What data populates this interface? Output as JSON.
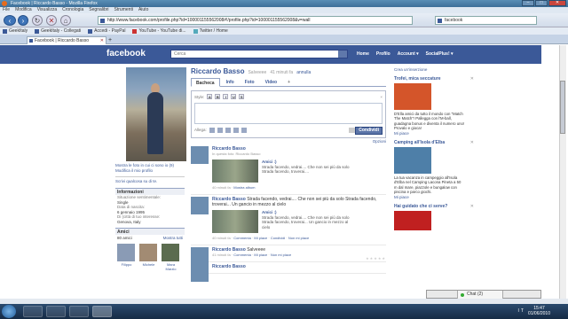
{
  "window": {
    "title": "Facebook | Riccardo Basso - Mozilla Firefox",
    "menu": [
      "File",
      "Modifica",
      "Visualizza",
      "Cronologia",
      "Segnalibri",
      "Strumenti",
      "Aiuto"
    ]
  },
  "browser": {
    "url": "http://www.facebook.com/profile.php?id=100001155562008#!/profile.php?id=100001155562008&v=wall",
    "search": "facebook",
    "bookmarks": [
      "GeekItaly",
      "GeekItaly - Collegati",
      "Accedi - PayPal",
      "YouTube - YouTube di...",
      "Twitter / Home"
    ],
    "tab_title": "Facebook | Riccardo Basso",
    "new_tab": "+"
  },
  "facebook": {
    "logo": "facebook",
    "search_placeholder": "Cerca",
    "nav": [
      "Home",
      "Profilo",
      "Account ▾",
      "SocialPlus! ▾"
    ]
  },
  "profile": {
    "name": "Riccardo Basso",
    "status": "Salveeee",
    "status_time": "41 minuti fa",
    "status_action": "annulla",
    "tabs": [
      "Bacheca",
      "Info",
      "Foto",
      "Video",
      "+"
    ],
    "left_links": [
      "Mostra le foto in cui ci sono io (9)",
      "Modifica il mio profilo"
    ],
    "about_link": "Scrivi qualcosa su di te.",
    "info_header": "Informazioni",
    "info": [
      {
        "label": "Situazione sentimentale:",
        "value": "Single"
      },
      {
        "label": "Data di nascita:",
        "value": "6 gennaio 1995"
      },
      {
        "label": "Di (città di tuo interesse:",
        "value": "Genova, Italy"
      }
    ],
    "friends_header": "Amici",
    "friends_count": "80 amici",
    "friends_all": "Mostra tutti",
    "friends": [
      "Filippo",
      "Michele",
      "Mara Marzio"
    ]
  },
  "composer": {
    "style_label": "Style:",
    "style_buttons": [
      "A",
      "B",
      "I",
      "U",
      "S"
    ],
    "attach_label": "Allega:",
    "post_button": "Condividi",
    "options": "Opzioni"
  },
  "posts": [
    {
      "author": "Riccardo Basso",
      "text": "",
      "sub": "In questa foto: Riccardo Basso",
      "attach_title": "Amici :)",
      "attach_text": "Strada facendo, vedrai.... Che non sei più da solo Strada facendo, troverai....",
      "meta_time": "40 minuti fa",
      "meta_actions": [
        "Mostra album"
      ]
    },
    {
      "author": "Riccardo Basso",
      "text": "Strada facendo, vedrai.... Che non sei più da solo Strada facendo, troverai... Un gancio in mezzo al cielo",
      "sub": "",
      "attach_title": "Amici :)",
      "attach_text": "Strada facendo, vedrai.... Che non sei più da solo Strada facendo, troverai... Un gancio in mezzo al cielo",
      "meta_time": "40 minuti fa",
      "meta_actions": [
        "Commenta",
        "Mi piace",
        "Condividi",
        "Non mi piace"
      ]
    },
    {
      "author": "Riccardo Basso",
      "text": "Salveeee",
      "sub": "",
      "attach_title": "",
      "attach_text": "",
      "meta_time": "41 minuti fa",
      "meta_actions": [
        "Commenta",
        "Mi piace",
        "Non mi piace"
      ]
    },
    {
      "author": "Riccardo Basso",
      "text": "",
      "sub": "",
      "attach_title": "",
      "attach_text": "",
      "meta_time": "",
      "meta_actions": []
    }
  ],
  "ads": {
    "create": "Crea un'inserzione",
    "items": [
      {
        "title": "Trofei, mica seccature",
        "text": "D'Ella amici da tutto il mondo con \"Match The Match\"! Pallegga con l'M-ball, guadagna bonus e diventa il numero uno! Provalo e gioca!",
        "like": "Mi piace",
        "color": "#d4552a"
      },
      {
        "title": "Camping all'Isola d'Elba",
        "text": "La tua vacanza in campeggio all'Isola d'Elba nel Camping Lacona Pineta a 50 m dal mare, piazzole e bungalow con piscina e parco giochi.",
        "like": "Mi piace",
        "color": "#4e7fa8"
      },
      {
        "title": "Hai guidato che ci serve?",
        "text": "",
        "like": "",
        "color": "#c02020"
      }
    ]
  },
  "chat": {
    "label": "Chat (2)"
  },
  "taskbar": {
    "lang": "IT",
    "time": "15:47",
    "date": "01/06/2010"
  },
  "colors": {
    "fb_blue": "#3b5998",
    "link": "#3b5998"
  }
}
